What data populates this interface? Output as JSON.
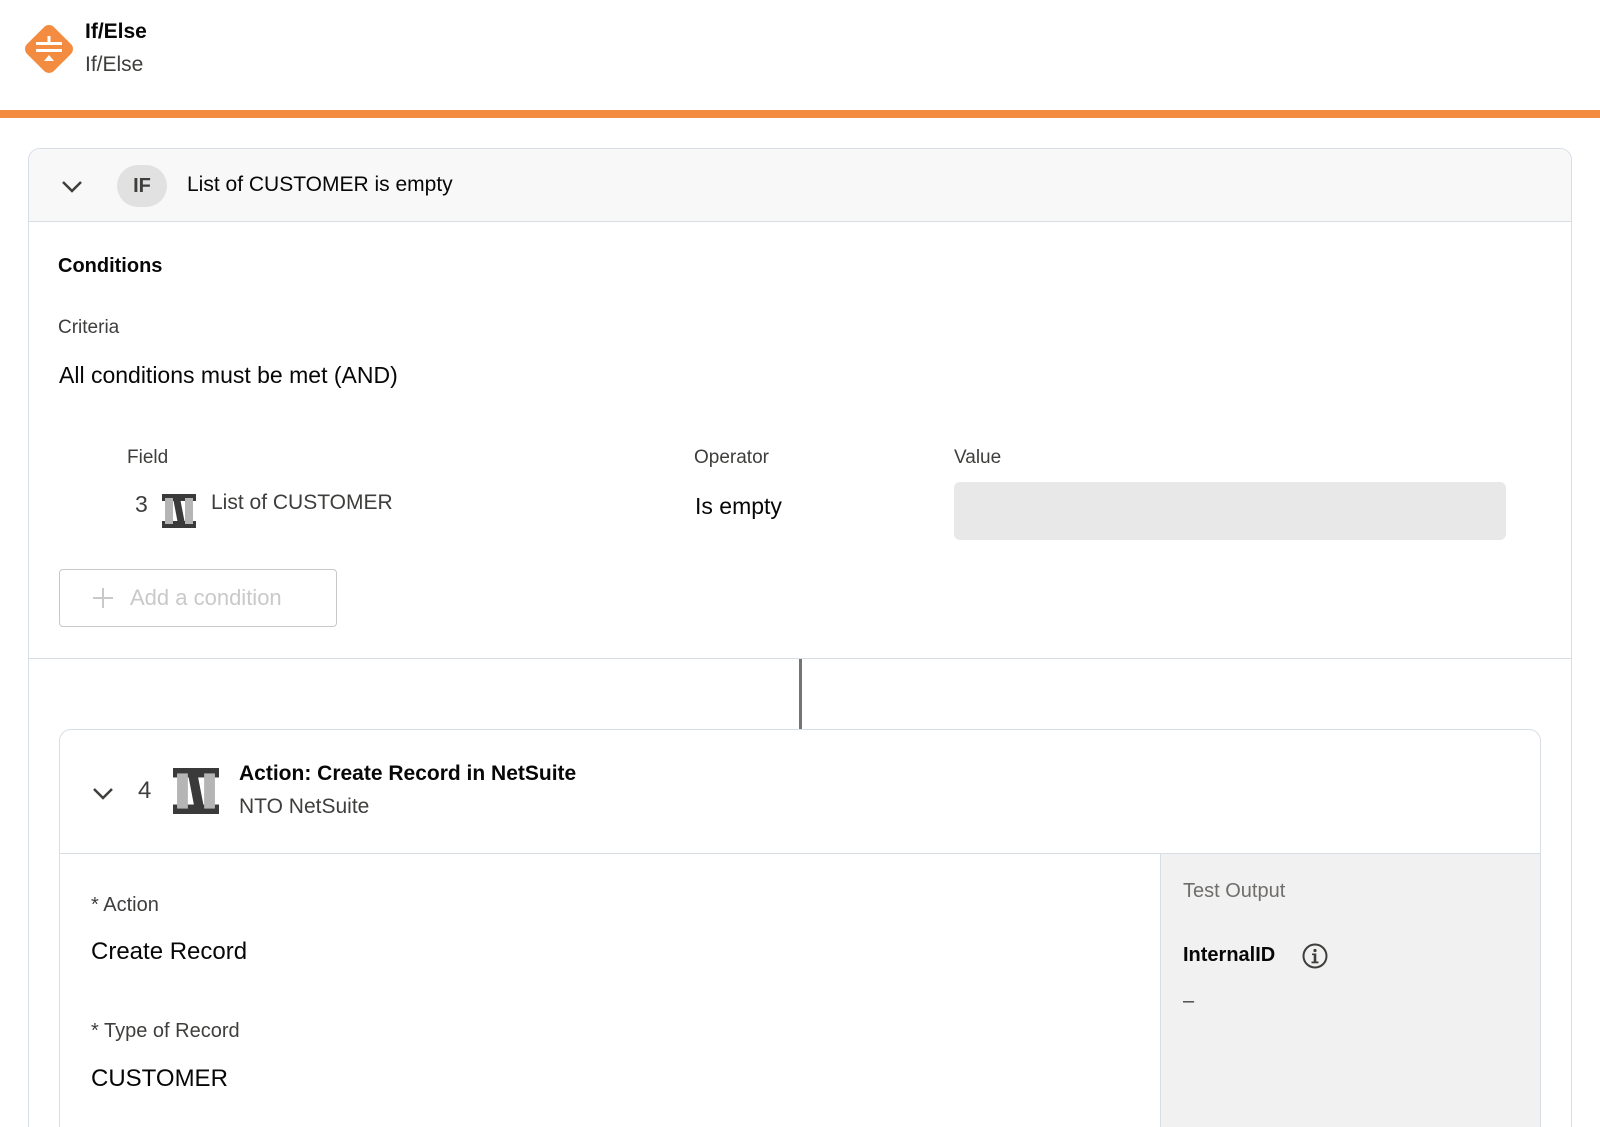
{
  "header": {
    "title": "If/Else",
    "subtitle": "If/Else",
    "icon": "if-else-diamond-icon",
    "accent_color": "#f38c40"
  },
  "if_block": {
    "badge": "IF",
    "summary": "List of CUSTOMER is empty",
    "conditions_heading": "Conditions",
    "criteria_label": "Criteria",
    "criteria_value": "All conditions must be met (AND)",
    "columns": {
      "field": "Field",
      "operator": "Operator",
      "value": "Value"
    },
    "condition": {
      "step_number": "3",
      "field": "List of CUSTOMER",
      "operator": "Is empty",
      "value": ""
    },
    "add_condition_label": "Add a condition"
  },
  "action": {
    "step_number": "4",
    "title": "Action: Create Record in NetSuite",
    "subtitle": "NTO NetSuite",
    "action_label": "* Action",
    "action_value": "Create Record",
    "type_label": "* Type of Record",
    "type_value": "CUSTOMER",
    "test_output": {
      "title": "Test Output",
      "field_label": "InternalID",
      "field_value": "–"
    }
  }
}
